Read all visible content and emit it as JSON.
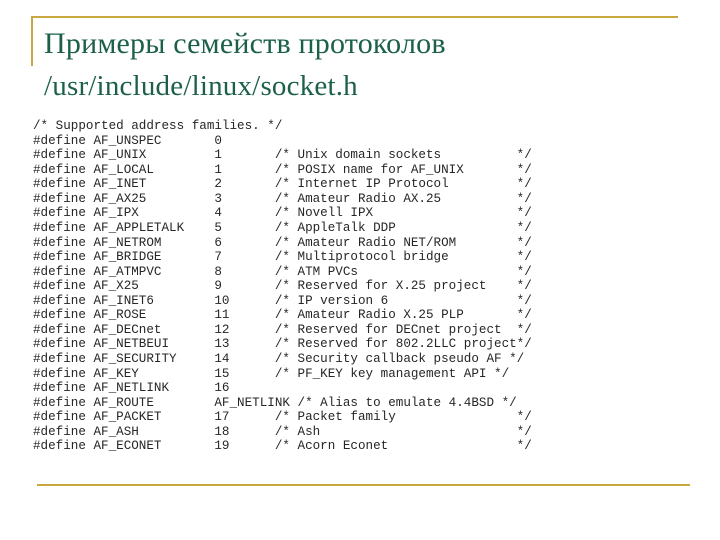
{
  "slide": {
    "title": "Примеры семейств протоколов",
    "subtitle": "/usr/include/linux/socket.h",
    "accent_color": "#c9a840",
    "title_color": "#1d6048",
    "code_color": "#262626",
    "background_color": "#ffffff"
  },
  "code": {
    "language": "c",
    "lines": [
      "/* Supported address families. */",
      "#define AF_UNSPEC       0",
      "#define AF_UNIX         1       /* Unix domain sockets          */",
      "#define AF_LOCAL        1       /* POSIX name for AF_UNIX       */",
      "#define AF_INET         2       /* Internet IP Protocol         */",
      "#define AF_AX25         3       /* Amateur Radio AX.25          */",
      "#define AF_IPX          4       /* Novell IPX                   */",
      "#define AF_APPLETALK    5       /* AppleTalk DDP                */",
      "#define AF_NETROM       6       /* Amateur Radio NET/ROM        */",
      "#define AF_BRIDGE       7       /* Multiprotocol bridge         */",
      "#define AF_ATMPVC       8       /* ATM PVCs                     */",
      "#define AF_X25          9       /* Reserved for X.25 project    */",
      "#define AF_INET6        10      /* IP version 6                 */",
      "#define AF_ROSE         11      /* Amateur Radio X.25 PLP       */",
      "#define AF_DECnet       12      /* Reserved for DECnet project  */",
      "#define AF_NETBEUI      13      /* Reserved for 802.2LLC project*/",
      "#define AF_SECURITY     14      /* Security callback pseudo AF */",
      "#define AF_KEY          15      /* PF_KEY key management API */",
      "#define AF_NETLINK      16",
      "#define AF_ROUTE        AF_NETLINK /* Alias to emulate 4.4BSD */",
      "#define AF_PACKET       17      /* Packet family                */",
      "#define AF_ASH          18      /* Ash                          */",
      "#define AF_ECONET       19      /* Acorn Econet                 */"
    ]
  }
}
